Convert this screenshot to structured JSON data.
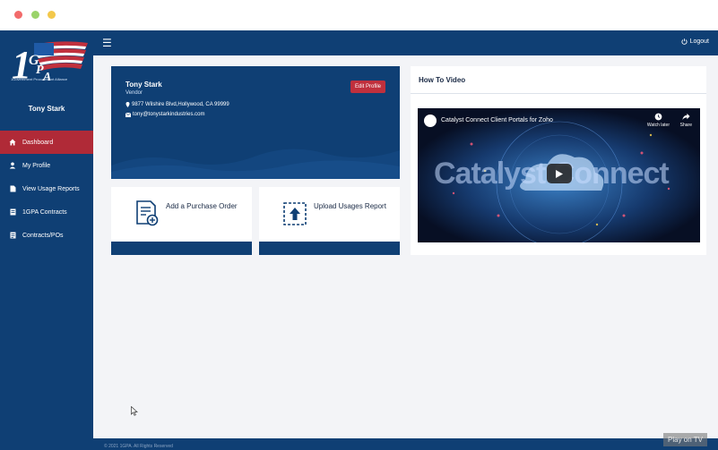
{
  "sidebar": {
    "logo_text": "1Government Procurement Alliance",
    "user_name": "Tony Stark",
    "items": [
      {
        "label": "Dashboard",
        "icon": "home-icon",
        "active": true
      },
      {
        "label": "My Profile",
        "icon": "user-icon",
        "active": false
      },
      {
        "label": "View Usage Reports",
        "icon": "document-icon",
        "active": false
      },
      {
        "label": "1GPA Contracts",
        "icon": "contract-icon",
        "active": false
      },
      {
        "label": "Contracts/POs",
        "icon": "contracts-po-icon",
        "active": false
      }
    ]
  },
  "topbar": {
    "menu_icon": "hamburger-icon",
    "logout_label": "Logout"
  },
  "profile": {
    "name": "Tony Stark",
    "role": "Vendor",
    "address": "9877 Wilshire Blvd,Hollywood, CA 99999",
    "email": "tony@tonystarkindustries.com",
    "edit_label": "Edit Profile"
  },
  "actions": {
    "purchase_order": "Add a Purchase Order",
    "upload_usage": "Upload Usages Report"
  },
  "video": {
    "section_title": "How To Video",
    "title": "Catalyst Connect Client Portals for Zoho",
    "watch_later": "Watch later",
    "share": "Share",
    "brand_text": "Catalyst Connect"
  },
  "footer": {
    "copyright": "© 2021 1GPA. All Rights Reserved",
    "play_tv": "Play on TV"
  },
  "colors": {
    "primary": "#0f3f74",
    "accent": "#b02a37",
    "background": "#f3f4f7"
  }
}
